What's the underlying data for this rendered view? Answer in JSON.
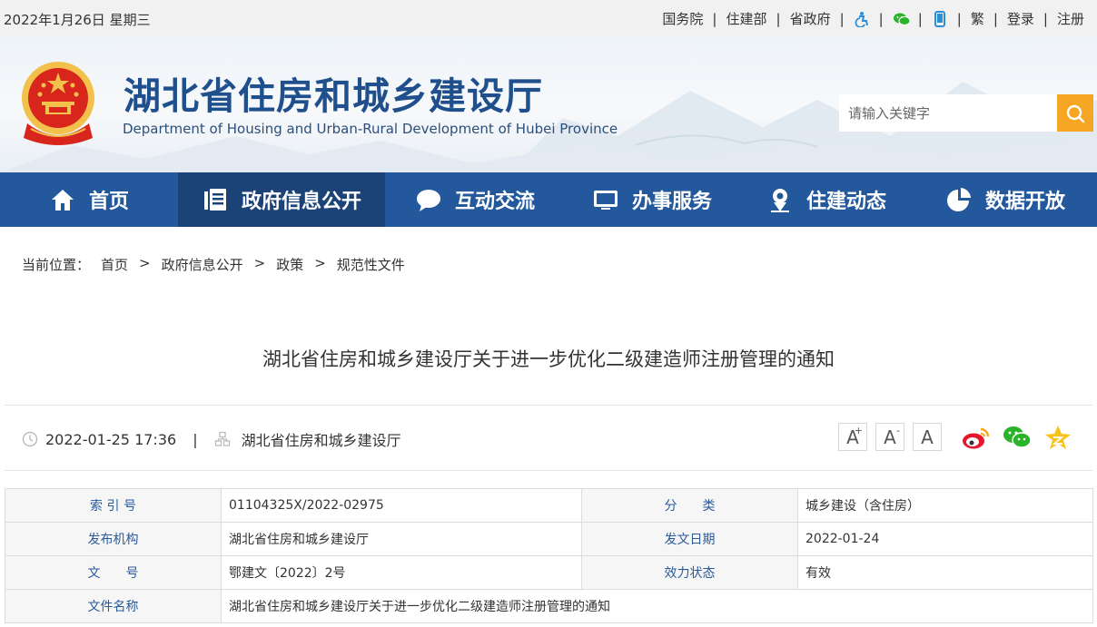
{
  "topbar": {
    "date": "2022年1月26日 星期三",
    "links": [
      "国务院",
      "住建部",
      "省政府"
    ],
    "traditional": "繁",
    "login": "登录",
    "register": "注册",
    "icons": [
      "accessibility-icon",
      "wechat-icon",
      "mobile-icon"
    ]
  },
  "header": {
    "title": "湖北省住房和城乡建设厅",
    "subtitle": "Department of Housing and Urban-Rural Development of Hubei Province",
    "search_placeholder": "请输入关键字"
  },
  "nav": {
    "items": [
      {
        "label": "首页",
        "icon": "home-icon"
      },
      {
        "label": "政府信息公开",
        "icon": "document-icon"
      },
      {
        "label": "互动交流",
        "icon": "chat-icon"
      },
      {
        "label": "办事服务",
        "icon": "monitor-icon"
      },
      {
        "label": "住建动态",
        "icon": "location-icon"
      },
      {
        "label": "数据开放",
        "icon": "pie-chart-icon"
      }
    ],
    "active_index": 1
  },
  "breadcrumb": {
    "prefix": "当前位置：",
    "items": [
      "首页",
      "政府信息公开",
      "政策",
      "规范性文件"
    ],
    "arrow": ">"
  },
  "article": {
    "title": "湖北省住房和城乡建设厅关于进一步优化二级建造师注册管理的通知",
    "datetime": "2022-01-25 17:36",
    "source": "湖北省住房和城乡建设厅",
    "divider": "|"
  },
  "font_controls": {
    "large": "A",
    "large_sup": "+",
    "small": "A",
    "small_sup": "-",
    "normal": "A"
  },
  "info_table": {
    "rows": [
      {
        "k1": "索 引 号",
        "v1": "01104325X/2022-02975",
        "k2": "分　　类",
        "v2": "城乡建设（含住房）"
      },
      {
        "k1": "发布机构",
        "v1": "湖北省住房和城乡建设厅",
        "k2": "发文日期",
        "v2": "2022-01-24"
      },
      {
        "k1": "文　　号",
        "v1": "鄂建文〔2022〕2号",
        "k2": "效力状态",
        "v2": "有效"
      }
    ],
    "name_key": "文件名称",
    "name_value": "湖北省住房和城乡建设厅关于进一步优化二级建造师注册管理的通知"
  },
  "colors": {
    "nav_bg": "#23589c",
    "nav_active": "#1b4378",
    "title_blue": "#1f4f8c",
    "search_button": "#f5a623",
    "table_key": "#2a5a9c"
  }
}
